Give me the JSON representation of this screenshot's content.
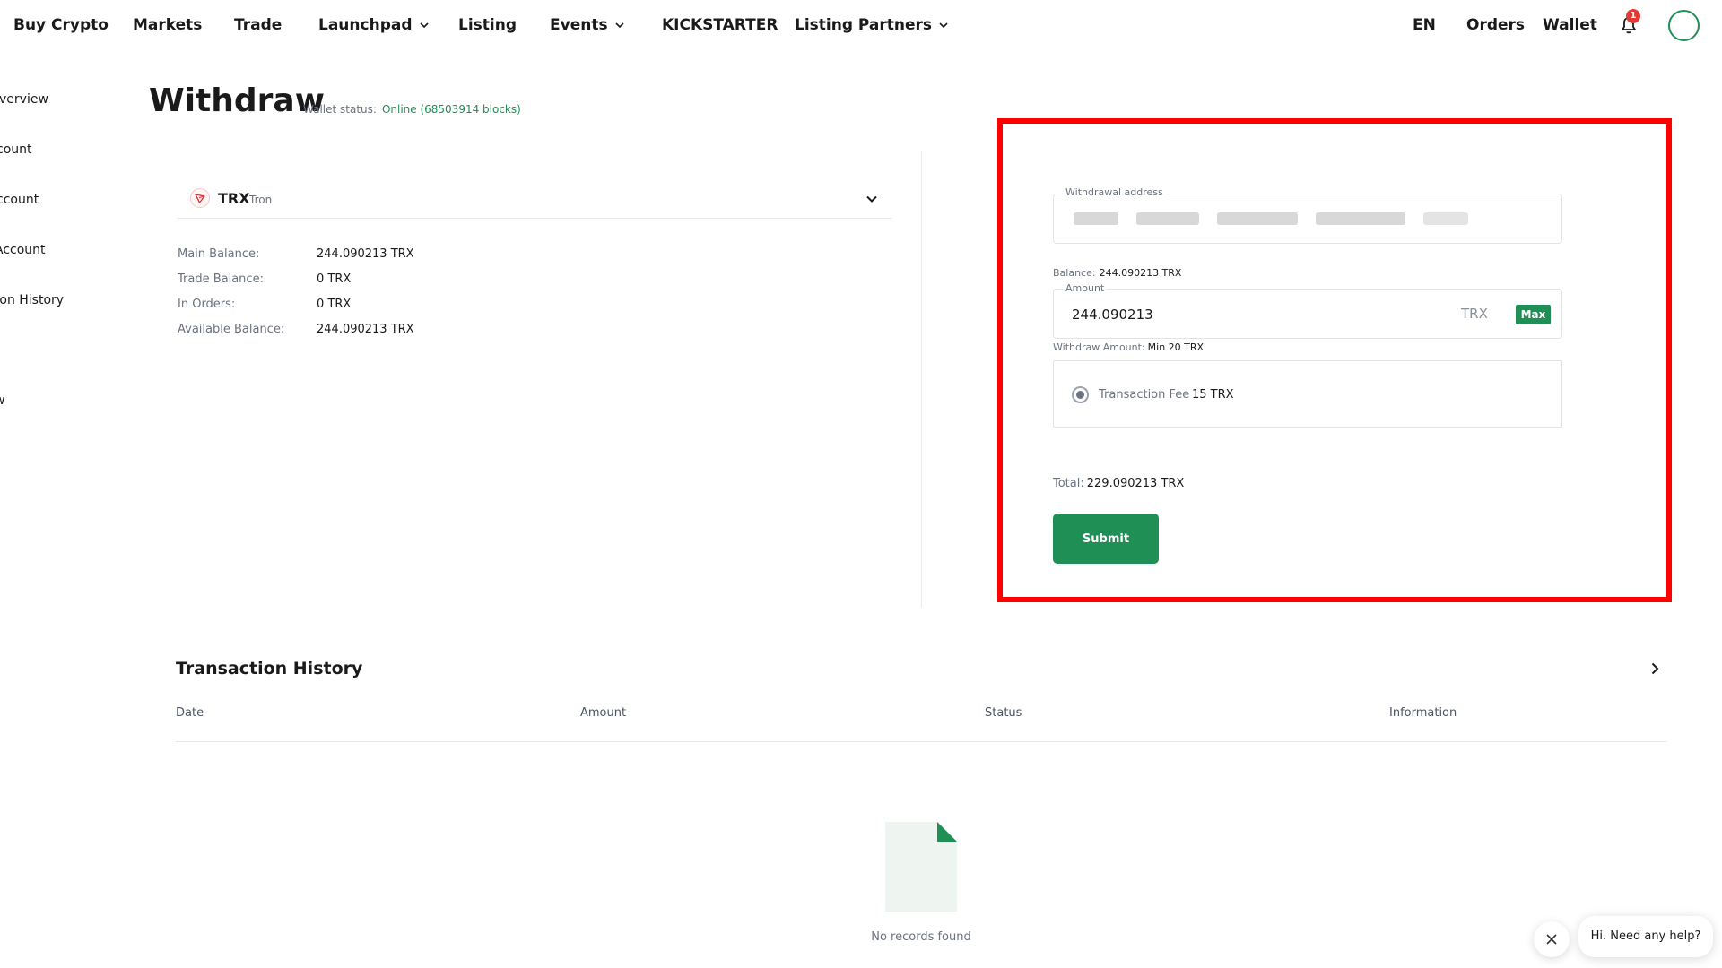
{
  "nav": {
    "items": [
      "Buy Crypto",
      "Markets",
      "Trade",
      "Launchpad",
      "Listing",
      "Events",
      "KICKSTARTER",
      "Listing Partners"
    ],
    "right": {
      "lang": "EN",
      "orders": "Orders",
      "wallet": "Wallet"
    },
    "notification_count": "1"
  },
  "sidebar": {
    "items": [
      "Overview",
      "count",
      "ccount",
      "Account",
      "tion History",
      "w"
    ]
  },
  "page": {
    "title": "Withdraw",
    "wallet_status_label": "Wallet status:",
    "wallet_status_value": "Online (68503914 blocks)"
  },
  "coin": {
    "symbol": "TRX",
    "name": "Tron"
  },
  "balances": [
    {
      "label": "Main Balance:",
      "value": "244.090213 TRX"
    },
    {
      "label": "Trade Balance:",
      "value": "0 TRX"
    },
    {
      "label": "In Orders:",
      "value": "0 TRX"
    },
    {
      "label": "Available Balance:",
      "value": "244.090213 TRX"
    }
  ],
  "form": {
    "address_label": "Withdrawal address",
    "balance_label": "Balance:",
    "balance_value": "244.090213 TRX",
    "amount_label": "Amount",
    "amount_value": "244.090213",
    "amount_unit": "TRX",
    "max_label": "Max",
    "withdraw_amount_label": "Withdraw Amount:",
    "withdraw_amount_value": "Min 20 TRX",
    "fee_label": "Transaction Fee",
    "fee_value": "15 TRX",
    "total_label": "Total:",
    "total_value": "229.090213 TRX",
    "submit_label": "Submit"
  },
  "history": {
    "title": "Transaction History",
    "columns": [
      "Date",
      "Amount",
      "Status",
      "Information"
    ],
    "empty_text": "No records found"
  },
  "chat": {
    "message": "Hi. Need any help?"
  },
  "colors": {
    "accent": "#1f8f55",
    "highlight": "#ff0000",
    "badge": "#e53935"
  }
}
